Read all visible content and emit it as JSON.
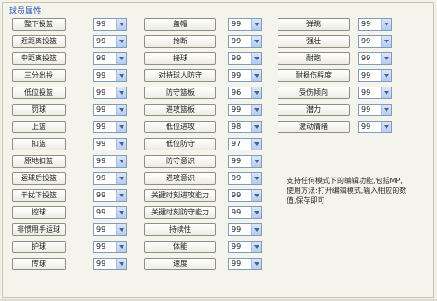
{
  "panel": {
    "title": "球员属性"
  },
  "columns": [
    [
      {
        "label": "整下投篮",
        "value": "99"
      },
      {
        "label": "近距离投篮",
        "value": "99"
      },
      {
        "label": "中距离投篮",
        "value": "99"
      },
      {
        "label": "三分出投",
        "value": "99"
      },
      {
        "label": "低位投篮",
        "value": "99"
      },
      {
        "label": "罚球",
        "value": "99"
      },
      {
        "label": "上篮",
        "value": "99"
      },
      {
        "label": "扣篮",
        "value": "99"
      },
      {
        "label": "原地扣篮",
        "value": "99"
      },
      {
        "label": "运球后投篮",
        "value": "99"
      },
      {
        "label": "干扰下投篮",
        "value": "99"
      },
      {
        "label": "控球",
        "value": "99"
      },
      {
        "label": "非惯用手运球",
        "value": "99"
      },
      {
        "label": "护球",
        "value": "99"
      },
      {
        "label": "传球",
        "value": "99"
      }
    ],
    [
      {
        "label": "盖帽",
        "value": "99"
      },
      {
        "label": "抢断",
        "value": "99"
      },
      {
        "label": "接球",
        "value": "99"
      },
      {
        "label": "对持球人防守",
        "value": "99"
      },
      {
        "label": "防守篮板",
        "value": "96"
      },
      {
        "label": "进攻篮板",
        "value": "99"
      },
      {
        "label": "低位进攻",
        "value": "98"
      },
      {
        "label": "低位防守",
        "value": "97"
      },
      {
        "label": "防守意识",
        "value": "99"
      },
      {
        "label": "进攻意识",
        "value": "99"
      },
      {
        "label": "关键时刻进攻能力",
        "value": "99"
      },
      {
        "label": "关键时刻防守能力",
        "value": "99"
      },
      {
        "label": "持续性",
        "value": "99"
      },
      {
        "label": "体能",
        "value": "99"
      },
      {
        "label": "速度",
        "value": "99"
      }
    ],
    [
      {
        "label": "弹跳",
        "value": "99"
      },
      {
        "label": "强壮",
        "value": "99"
      },
      {
        "label": "耐跑",
        "value": "99"
      },
      {
        "label": "耐损伤程度",
        "value": "99"
      },
      {
        "label": "受伤倾向",
        "value": "99"
      },
      {
        "label": "潜力",
        "value": "99"
      },
      {
        "label": "激动情绪",
        "value": "99"
      }
    ]
  ],
  "hint": {
    "lines": [
      "支持任何模式下的编辑功能,包括MP,",
      "使用方法:打开编辑模式,输入相应的数",
      "值,保存即可"
    ]
  }
}
